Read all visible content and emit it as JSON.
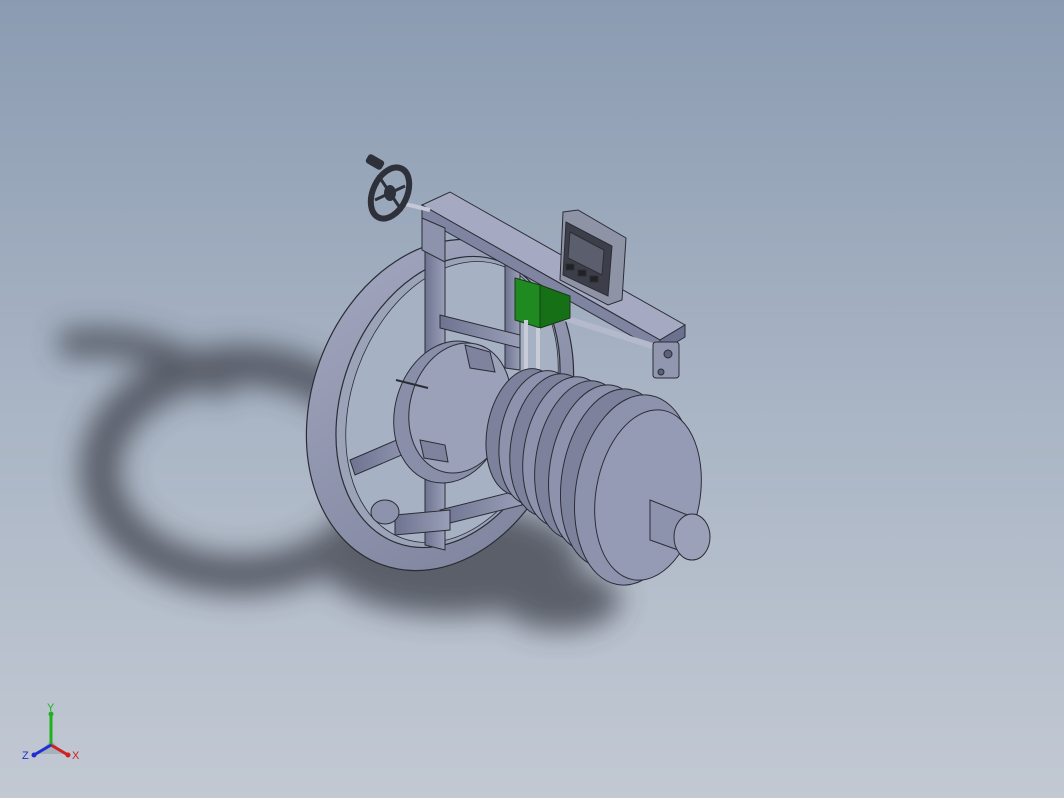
{
  "viewport": {
    "background_top": "#8b9bb1",
    "background_bottom": "#c2c9d3"
  },
  "model": {
    "body_color": "#8e93ad",
    "edge_color": "#2b2d36",
    "sensor_color": "#1f8a1f",
    "shadow_color": "#3c4048"
  },
  "triad": {
    "x_label": "X",
    "y_label": "Y",
    "z_label": "Z",
    "x_color": "#d02020",
    "y_color": "#20b020",
    "z_color": "#2030d0"
  }
}
